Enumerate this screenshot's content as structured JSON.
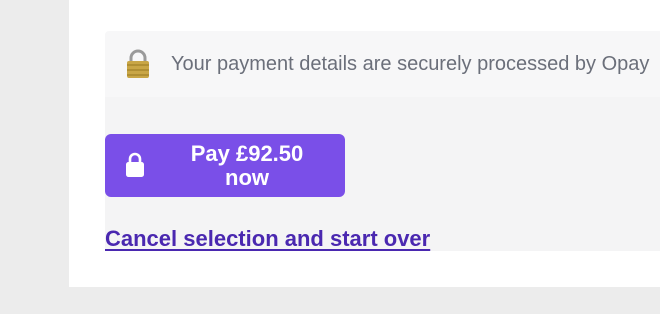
{
  "security_notice": {
    "icon": "padlock-icon",
    "text": "Your payment details are securely processed by Opay"
  },
  "pay_button": {
    "icon": "lock-icon",
    "label": "Pay £92.50 now"
  },
  "cancel_link": {
    "label": "Cancel selection and start over"
  },
  "colors": {
    "accent": "#7a4fe8",
    "link": "#4a28b0",
    "background": "#ececec"
  }
}
